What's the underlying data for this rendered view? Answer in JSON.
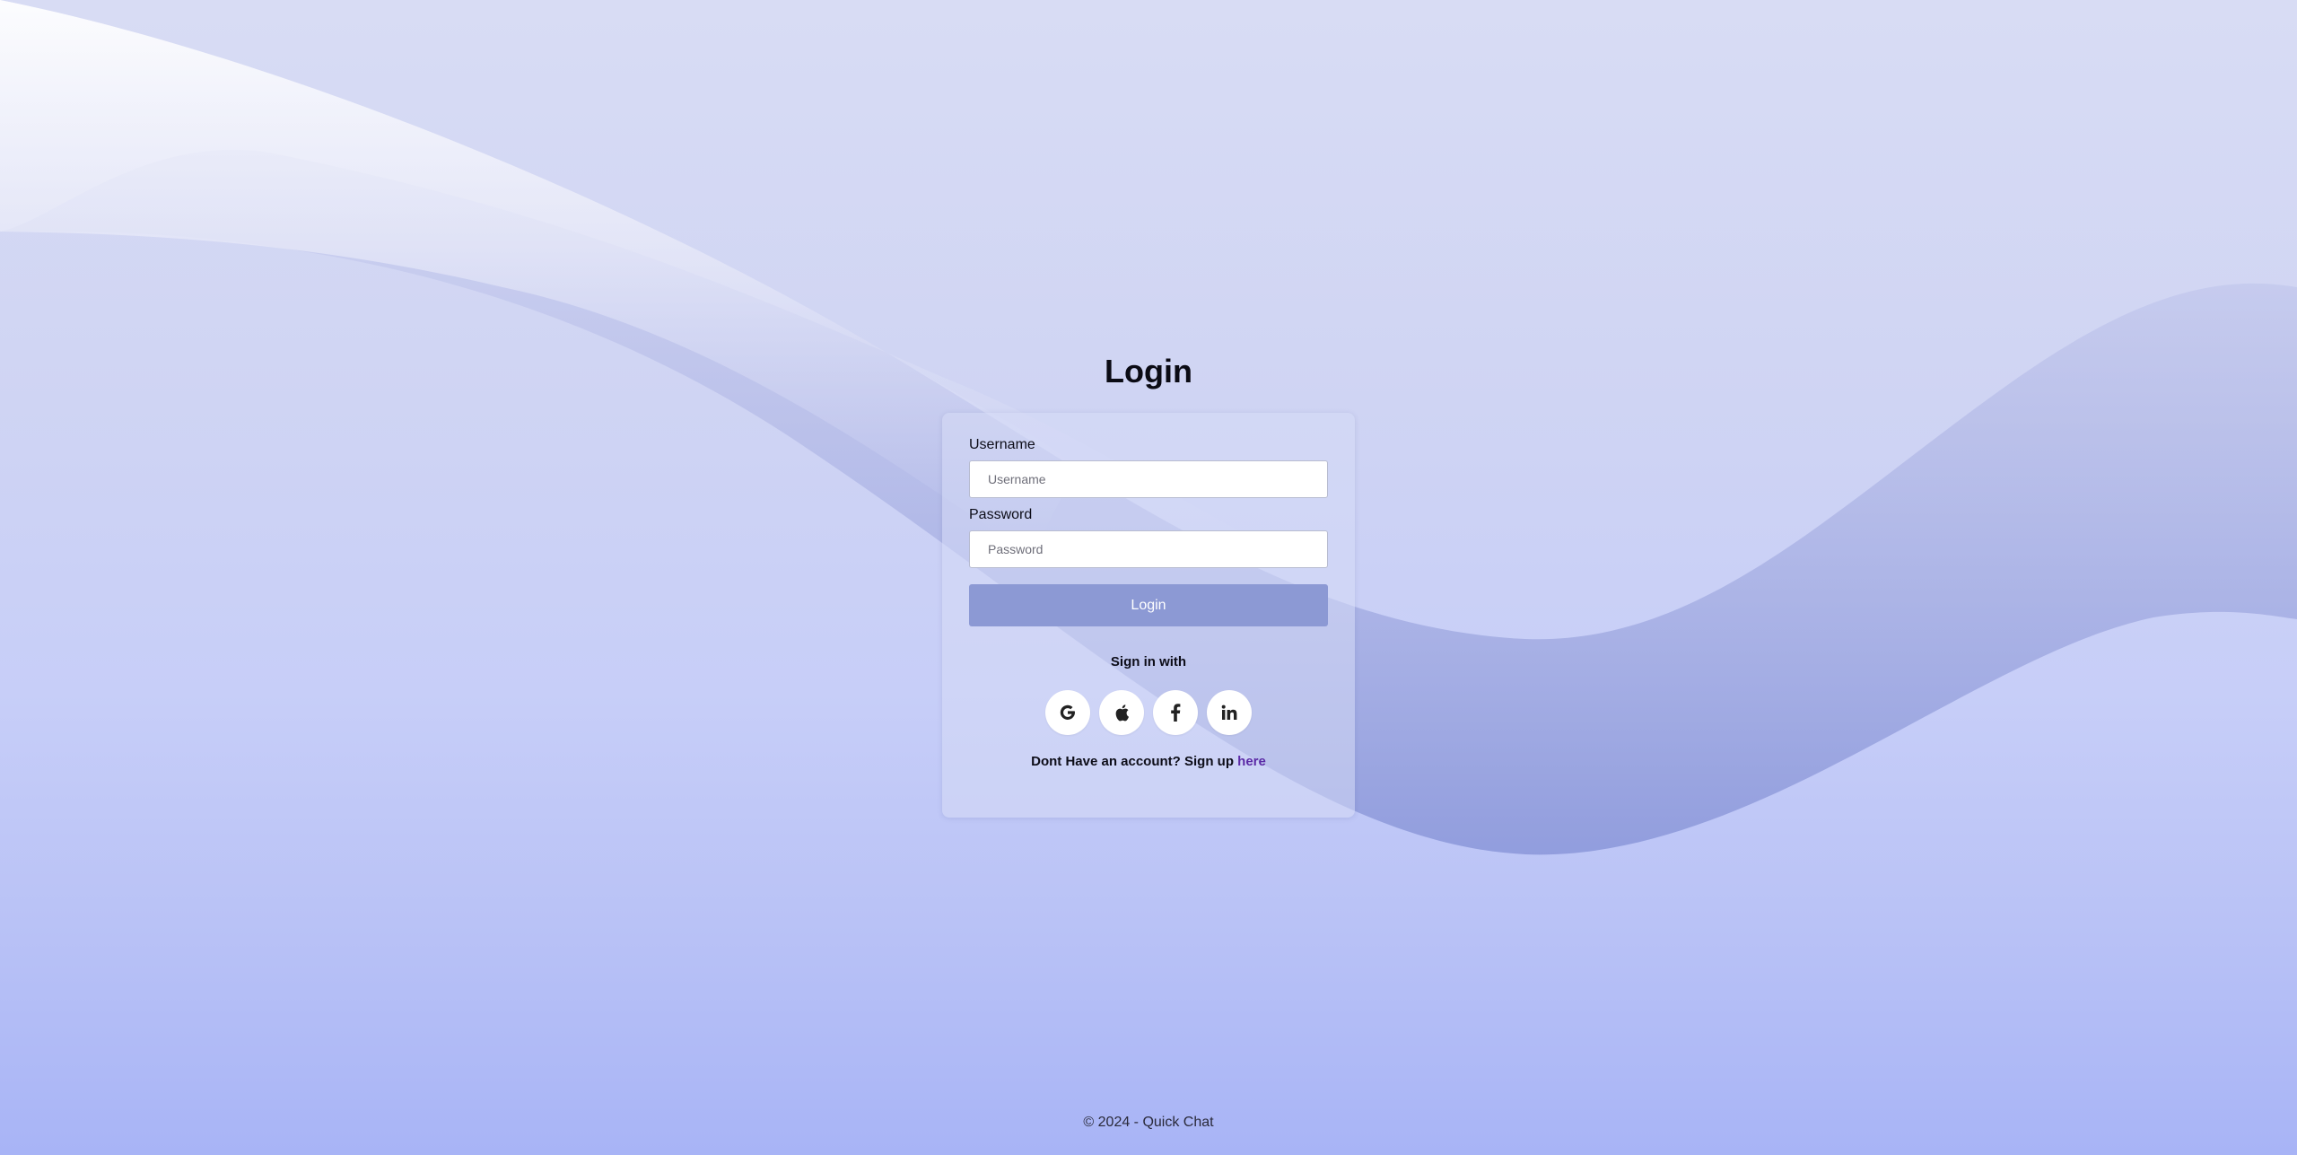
{
  "page": {
    "title": "Login"
  },
  "form": {
    "username_label": "Username",
    "username_placeholder": "Username",
    "username_value": "",
    "password_label": "Password",
    "password_placeholder": "Password",
    "password_value": "",
    "login_button": "Login"
  },
  "social": {
    "heading": "Sign in with",
    "providers": [
      {
        "name": "Google",
        "icon": "google-icon"
      },
      {
        "name": "Apple",
        "icon": "apple-icon"
      },
      {
        "name": "Facebook",
        "icon": "facebook-icon"
      },
      {
        "name": "LinkedIn",
        "icon": "linkedin-icon"
      }
    ]
  },
  "signup": {
    "prompt": "Dont Have an account? Sign up ",
    "link_text": "here"
  },
  "footer": {
    "text": "© 2024 - Quick Chat"
  },
  "colors": {
    "accent_button": "#8c99d4",
    "link": "#5b2aa6",
    "background_top": "#d8dcf4",
    "background_bottom": "#a8b4f6"
  }
}
